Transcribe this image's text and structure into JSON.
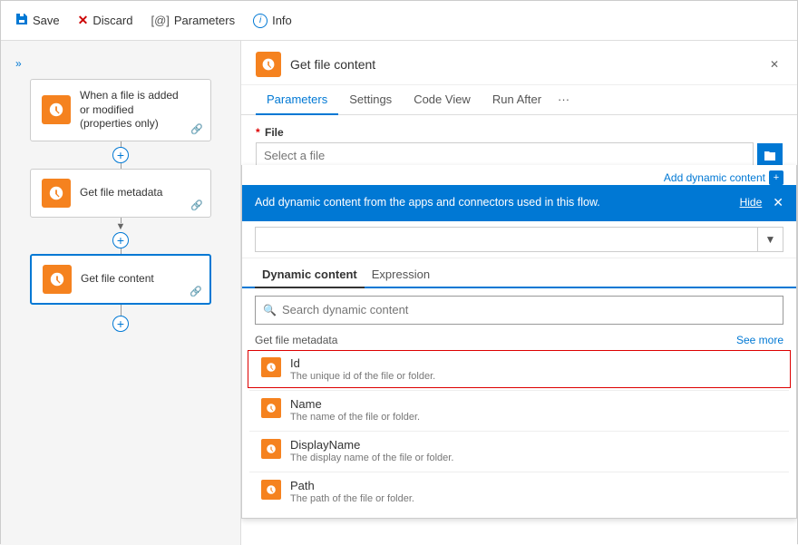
{
  "toolbar": {
    "save_label": "Save",
    "discard_label": "Discard",
    "parameters_label": "Parameters",
    "info_label": "Info"
  },
  "flow": {
    "cards": [
      {
        "id": "trigger",
        "title": "When a file is added\nor modified\n(properties only)"
      },
      {
        "id": "metadata",
        "title": "Get file metadata"
      },
      {
        "id": "content",
        "title": "Get file content"
      }
    ]
  },
  "panel": {
    "title": "Get file content",
    "tabs": [
      "Parameters",
      "Settings",
      "Code View",
      "Run After",
      "..."
    ],
    "active_tab": "Parameters",
    "file_field": {
      "label": "File",
      "placeholder": "Select a file"
    }
  },
  "dynamic_content": {
    "banner_text": "Add dynamic content from the apps and connectors used in this flow.",
    "hide_label": "Hide",
    "add_dynamic_label": "Add dynamic content",
    "tabs": [
      "Dynamic content",
      "Expression"
    ],
    "active_tab": "Dynamic content",
    "search_placeholder": "Search dynamic content",
    "section_title": "Get file metadata",
    "see_more_label": "See more",
    "items": [
      {
        "name": "Id",
        "description": "The unique id of the file or folder.",
        "selected": true
      },
      {
        "name": "Name",
        "description": "The name of the file or folder.",
        "selected": false
      },
      {
        "name": "DisplayName",
        "description": "The display name of the file or folder.",
        "selected": false
      },
      {
        "name": "Path",
        "description": "The path of the file or folder.",
        "selected": false
      }
    ]
  }
}
